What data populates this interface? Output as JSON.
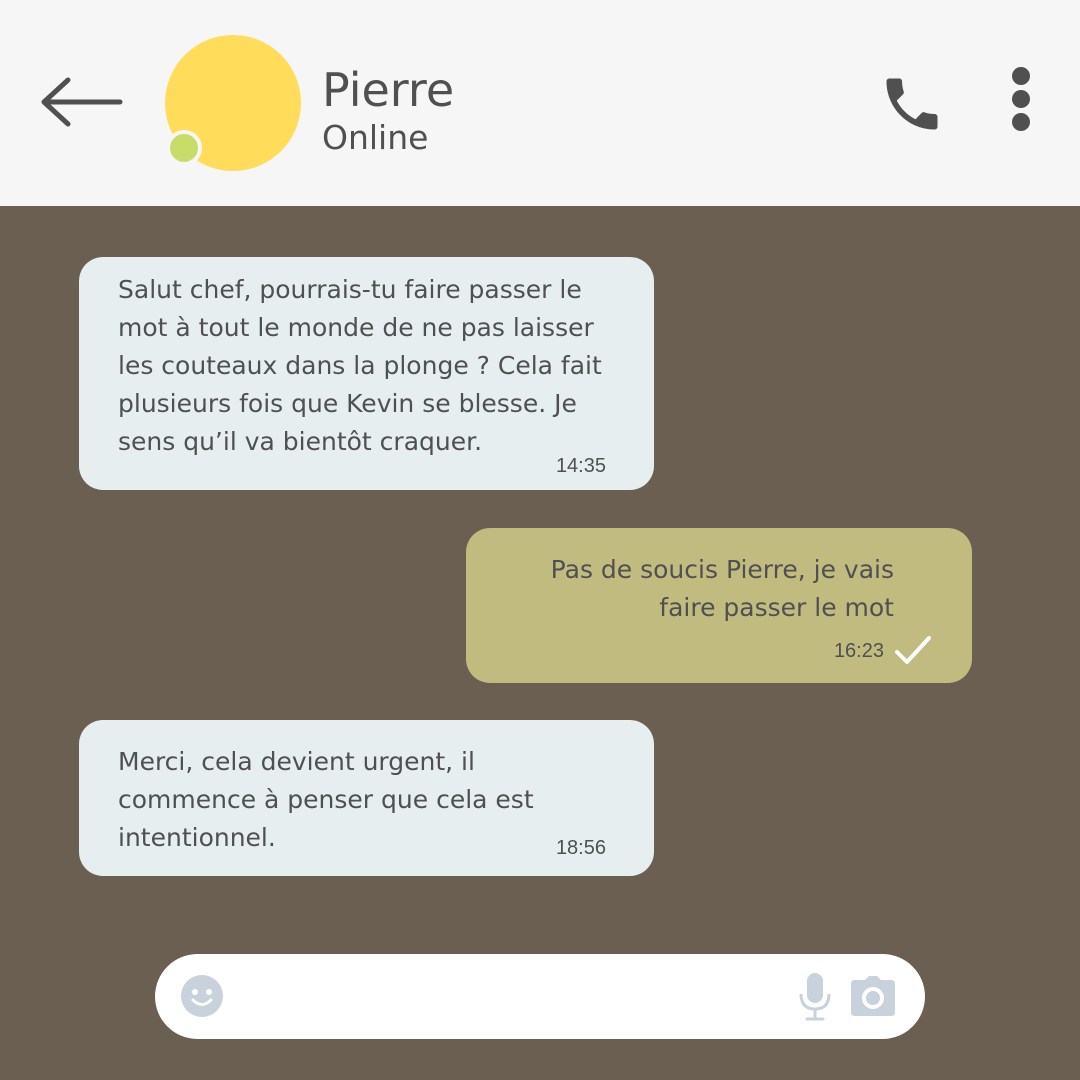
{
  "header": {
    "contact_name": "Pierre",
    "contact_status": "Online",
    "icons": {
      "back": "arrow-left-icon",
      "call": "phone-icon",
      "menu": "more-vertical-icon"
    }
  },
  "messages": [
    {
      "direction": "incoming",
      "text": "Salut chef, pourrais-tu faire passer le mot à tout le monde de ne pas laisser les couteaux dans la plonge ? Cela fait plusieurs fois que Kevin se blesse. Je sens qu’il va bientôt craquer.",
      "time": "14:35"
    },
    {
      "direction": "outgoing",
      "text": "Pas de soucis Pierre, je vais faire passer le mot",
      "time": "16:23",
      "status_icon": "check-icon"
    },
    {
      "direction": "incoming",
      "text": "Merci, cela devient urgent, il commence à penser que cela est intentionnel.",
      "time": "18:56"
    }
  ],
  "composer": {
    "placeholder": "",
    "value": "",
    "icons": {
      "emoji": "emoji-icon",
      "mic": "microphone-icon",
      "camera": "camera-icon"
    }
  },
  "colors": {
    "chat_background": "#6a5f50",
    "header_background": "#f6f6f6",
    "incoming_bubble": "#e6eef0",
    "outgoing_bubble": "#c2bb7f",
    "avatar": "#ffdd5a",
    "presence_online": "#c8dc6a",
    "text": "#505050",
    "composer_icons": "#c8d2dc"
  }
}
